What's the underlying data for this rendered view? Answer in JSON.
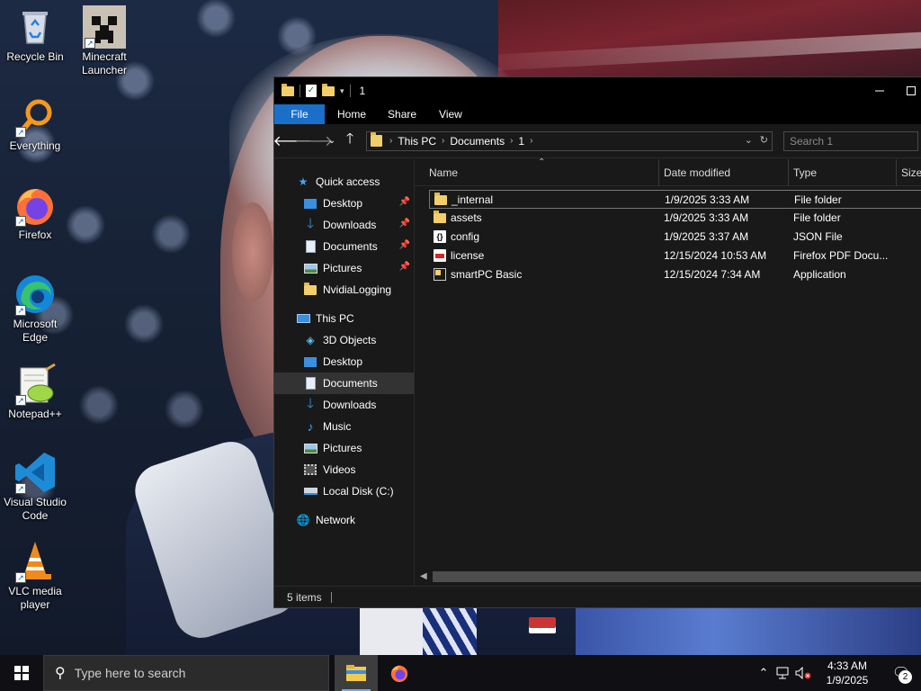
{
  "desktop": {
    "icons": [
      {
        "label": "Recycle Bin",
        "icon": "recycle-bin-icon"
      },
      {
        "label": "Minecraft\nLauncher",
        "icon": "minecraft-icon"
      },
      {
        "label": "Everything",
        "icon": "everything-search-icon"
      },
      {
        "label": "Firefox",
        "icon": "firefox-icon"
      },
      {
        "label": "Microsoft\nEdge",
        "icon": "edge-icon"
      },
      {
        "label": "Notepad++",
        "icon": "notepadpp-icon"
      },
      {
        "label": "Visual Studio\nCode",
        "icon": "vscode-icon"
      },
      {
        "label": "VLC media\nplayer",
        "icon": "vlc-icon"
      }
    ]
  },
  "explorer": {
    "title": "1",
    "ribbon": {
      "tabs": [
        "File",
        "Home",
        "Share",
        "View"
      ]
    },
    "address": {
      "crumbs": [
        "This PC",
        "Documents",
        "1"
      ]
    },
    "search": {
      "placeholder": "Search 1"
    },
    "nav": {
      "quick_access": "Quick access",
      "quick_items": [
        {
          "label": "Desktop",
          "icon": "desktop-icon",
          "pinned": true
        },
        {
          "label": "Downloads",
          "icon": "download-icon",
          "pinned": true
        },
        {
          "label": "Documents",
          "icon": "documents-icon",
          "pinned": true
        },
        {
          "label": "Pictures",
          "icon": "pictures-icon",
          "pinned": true
        },
        {
          "label": "NvidiaLogging",
          "icon": "folder-icon",
          "pinned": false
        }
      ],
      "this_pc": "This PC",
      "pc_items": [
        {
          "label": "3D Objects",
          "icon": "3d-objects-icon"
        },
        {
          "label": "Desktop",
          "icon": "desktop-icon"
        },
        {
          "label": "Documents",
          "icon": "documents-icon",
          "selected": true
        },
        {
          "label": "Downloads",
          "icon": "download-icon"
        },
        {
          "label": "Music",
          "icon": "music-icon"
        },
        {
          "label": "Pictures",
          "icon": "pictures-icon"
        },
        {
          "label": "Videos",
          "icon": "videos-icon"
        },
        {
          "label": "Local Disk (C:)",
          "icon": "drive-icon"
        }
      ],
      "network": "Network"
    },
    "columns": [
      "Name",
      "Date modified",
      "Type",
      "Size"
    ],
    "files": [
      {
        "name": "_internal",
        "date": "1/9/2025 3:33 AM",
        "type": "File folder",
        "icon": "folder"
      },
      {
        "name": "assets",
        "date": "1/9/2025 3:33 AM",
        "type": "File folder",
        "icon": "folder"
      },
      {
        "name": "config",
        "date": "1/9/2025 3:37 AM",
        "type": "JSON File",
        "icon": "json"
      },
      {
        "name": "license",
        "date": "12/15/2024 10:53 AM",
        "type": "Firefox PDF Docu...",
        "icon": "pdf"
      },
      {
        "name": "smartPC Basic",
        "date": "12/15/2024 7:34 AM",
        "type": "Application",
        "icon": "app"
      }
    ],
    "status": {
      "items_count": "5 items"
    }
  },
  "taskbar": {
    "search_placeholder": "Type here to search",
    "clock_time": "4:33 AM",
    "clock_date": "1/9/2025",
    "notification_count": "2"
  }
}
